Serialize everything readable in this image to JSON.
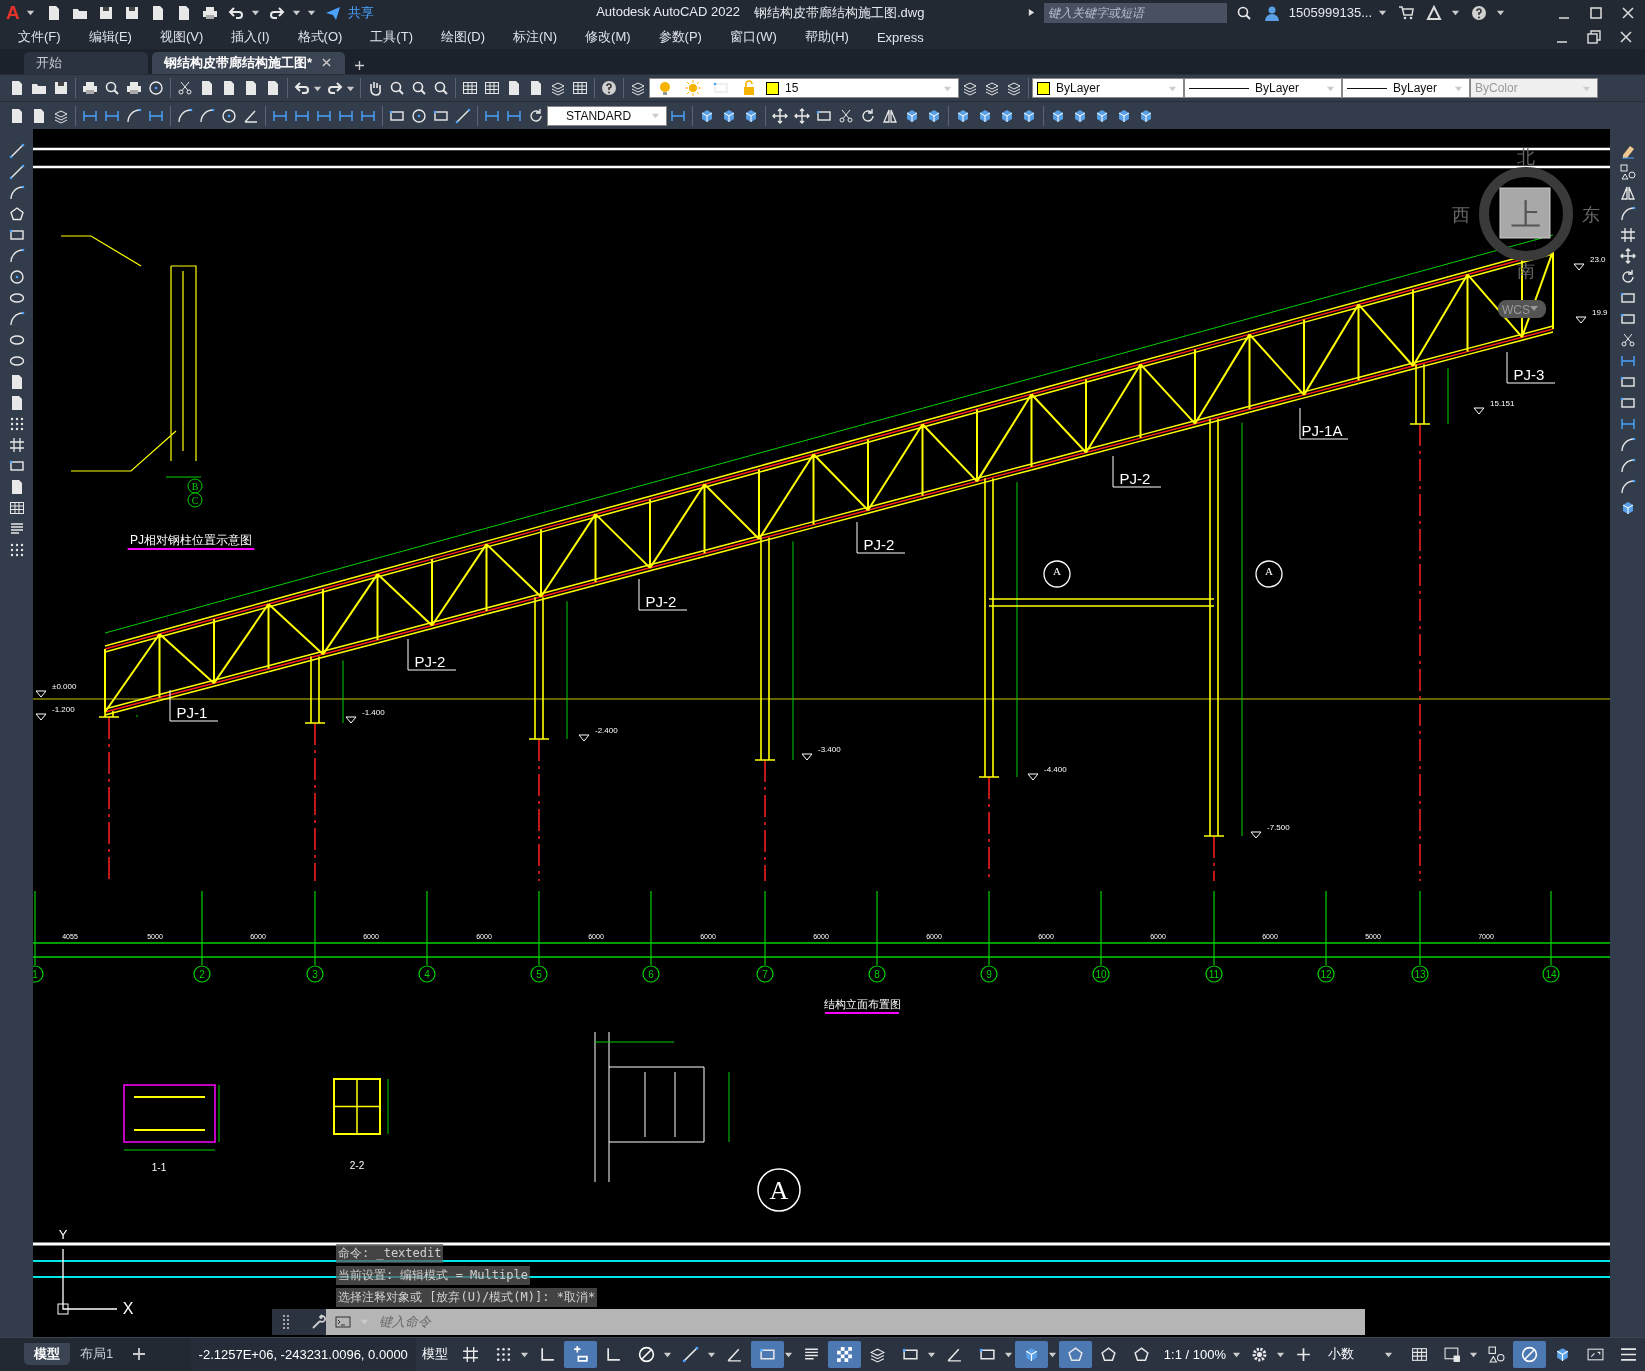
{
  "title_bar": {
    "app_logo": "A",
    "share": "共享",
    "app_title": "Autodesk AutoCAD 2022",
    "file_title": "钢结构皮带廊结构施工图.dwg",
    "search": {
      "placeholder": "键入关键字或短语"
    },
    "user": "1505999135..."
  },
  "menu": [
    "文件(F)",
    "编辑(E)",
    "视图(V)",
    "插入(I)",
    "格式(O)",
    "工具(T)",
    "绘图(D)",
    "标注(N)",
    "修改(M)",
    "参数(P)",
    "窗口(W)",
    "帮助(H)",
    "Express"
  ],
  "file_tabs": [
    {
      "label": "开始",
      "selected": false
    },
    {
      "label": "钢结构皮带廊结构施工图*",
      "selected": true
    }
  ],
  "properties": {
    "layer": {
      "name": "15",
      "color": "#ffff00"
    },
    "text_style": "STANDARD",
    "color": {
      "label": "ByLayer"
    },
    "linetype": "ByLayer",
    "lineweight": "ByLayer",
    "plot_style": {
      "label": "ByColor",
      "disabled": true
    }
  },
  "viewcube": {
    "north": "北",
    "south": "南",
    "west": "西",
    "east": "东",
    "face": "上",
    "ucs": "WCS"
  },
  "drawing": {
    "axes": [
      "1",
      "2",
      "3",
      "4",
      "5",
      "6",
      "7",
      "8",
      "9",
      "10",
      "11",
      "12",
      "13",
      "14"
    ],
    "axis_spans": [
      "4055",
      "5000",
      "6000",
      "6000",
      "6000",
      "6000",
      "6000",
      "6000",
      "6000",
      "6000",
      "6000",
      "6000",
      "5000",
      "7000"
    ],
    "truss_labels": [
      "PJ-1",
      "PJ-2",
      "PJ-2",
      "PJ-2",
      "PJ-2",
      "PJ-1A",
      "PJ-3"
    ],
    "elevations": [
      "±0.000",
      "-1.200",
      "-1.400",
      "-2.400",
      "-3.400",
      "-4.400",
      "-7.500",
      "15.151",
      "23.0",
      "19.9"
    ],
    "section_markers": [
      "A",
      "A"
    ],
    "detail_marker": "A",
    "grid_markers": [
      "B",
      "C"
    ],
    "titles": [
      "PJ相对钢柱位置示意图",
      "结构立面布置图",
      "1-1",
      "2-2"
    ],
    "ucs_axes": [
      "Y",
      "X"
    ]
  },
  "command_line": {
    "history": [
      "命令: _textedit",
      "当前设置: 编辑模式 = Multiple",
      "选择注释对象或 [放弃(U)/模式(M)]: *取消*"
    ],
    "placeholder": "键入命令"
  },
  "layout_tabs": [
    {
      "label": "模型",
      "selected": true
    },
    {
      "label": "布局1",
      "selected": false
    }
  ],
  "status_bar": {
    "coordinates": "-2.1257E+06, -243231.0096, 0.0000",
    "space": "模型",
    "annotation_scale": "1:1 / 100%",
    "units": "小数",
    "toggles": [
      {
        "kind": "grid",
        "on": false
      },
      {
        "kind": "snap",
        "on": false
      },
      {
        "kind": "infer",
        "on": false
      },
      {
        "kind": "cursor",
        "on": true
      },
      {
        "kind": "ortho",
        "on": false
      },
      {
        "kind": "polar",
        "on": false
      },
      {
        "kind": "tracking",
        "on": false
      },
      {
        "kind": "angle",
        "on": false
      },
      {
        "kind": "dynamic",
        "on": true
      },
      {
        "kind": "lineweight",
        "on": false
      },
      {
        "kind": "transparency",
        "on": true
      },
      {
        "kind": "cycling",
        "on": false
      },
      {
        "kind": "osnap3d",
        "on": false
      },
      {
        "kind": "ducs",
        "on": false
      },
      {
        "kind": "filter",
        "on": false
      },
      {
        "kind": "gizmo",
        "on": true
      },
      {
        "kind": "annovis",
        "on": true
      },
      {
        "kind": "autoscale",
        "on": false
      },
      {
        "kind": "annoscale",
        "on": false
      },
      {
        "kind": "workspace",
        "on": false
      },
      {
        "kind": "plus",
        "on": false
      },
      {
        "kind": "quickprops",
        "on": false
      },
      {
        "kind": "lockui",
        "on": false
      },
      {
        "kind": "isolate",
        "on": false
      },
      {
        "kind": "hardware",
        "on": true
      },
      {
        "kind": "cleanscreen",
        "on": false
      },
      {
        "kind": "fullscreen",
        "on": false
      },
      {
        "kind": "customize",
        "on": false
      }
    ]
  }
}
